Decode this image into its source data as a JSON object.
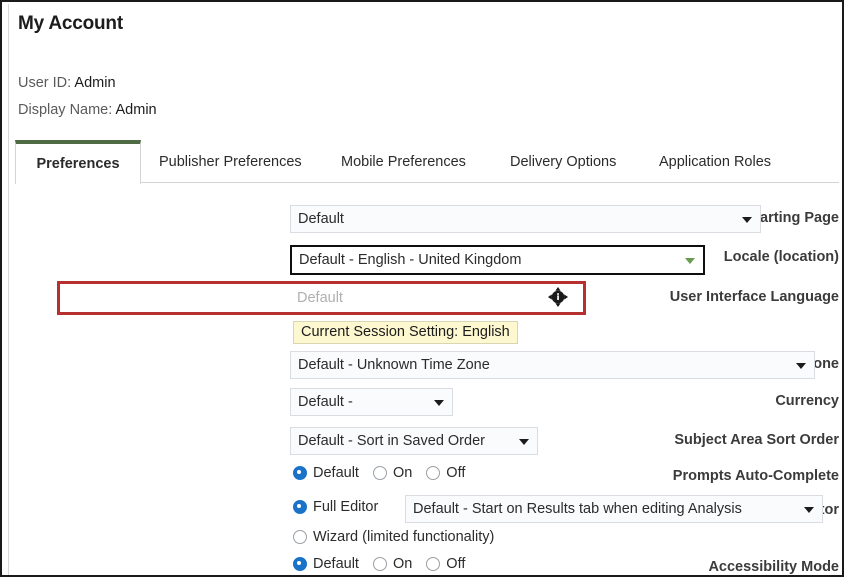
{
  "header": {
    "title": "My Account",
    "user_id_label": "User ID:",
    "user_id_value": "Admin",
    "display_name_label": "Display Name:",
    "display_name_value": "Admin"
  },
  "tabs": [
    {
      "label": "Preferences",
      "active": true
    },
    {
      "label": "Publisher Preferences",
      "active": false
    },
    {
      "label": "Mobile Preferences",
      "active": false
    },
    {
      "label": "Delivery Options",
      "active": false
    },
    {
      "label": "Application Roles",
      "active": false
    }
  ],
  "form": {
    "starting_page": {
      "label": "Starting Page",
      "value": "Default"
    },
    "locale": {
      "label": "Locale (location)",
      "value": "Default - English - United Kingdom"
    },
    "ui_language": {
      "label": "User Interface Language",
      "value": "Default",
      "info_icon": "info-icon",
      "session_note": "Current Session Setting: English"
    },
    "time_zone": {
      "label": "Time Zone",
      "value": "Default - Unknown Time Zone"
    },
    "currency": {
      "label": "Currency",
      "value": "Default - "
    },
    "subject_area_sort_order": {
      "label": "Subject Area Sort Order",
      "value": "Default - Sort in Saved Order"
    },
    "prompts_auto_complete": {
      "label": "Prompts Auto-Complete",
      "options": [
        {
          "label": "Default",
          "selected": true
        },
        {
          "label": "On",
          "selected": false
        },
        {
          "label": "Off",
          "selected": false
        }
      ]
    },
    "analysis_editor": {
      "label": "Analysis Editor",
      "full_editor": {
        "label": "Full Editor",
        "selected": true
      },
      "full_editor_value": "Default - Start on Results tab when editing Analysis",
      "wizard": {
        "label": "Wizard (limited functionality)",
        "selected": false
      }
    },
    "accessibility_mode": {
      "label": "Accessibility Mode",
      "options": [
        {
          "label": "Default",
          "selected": true
        },
        {
          "label": "On",
          "selected": false
        },
        {
          "label": "Off",
          "selected": false
        }
      ]
    }
  },
  "colors": {
    "tab_accent": "#4e6b43",
    "highlight_box": "#b5302f",
    "note_background": "#fdf8cf",
    "radio_selected": "#1a73c9",
    "focus_arrow": "#6a9a50"
  }
}
